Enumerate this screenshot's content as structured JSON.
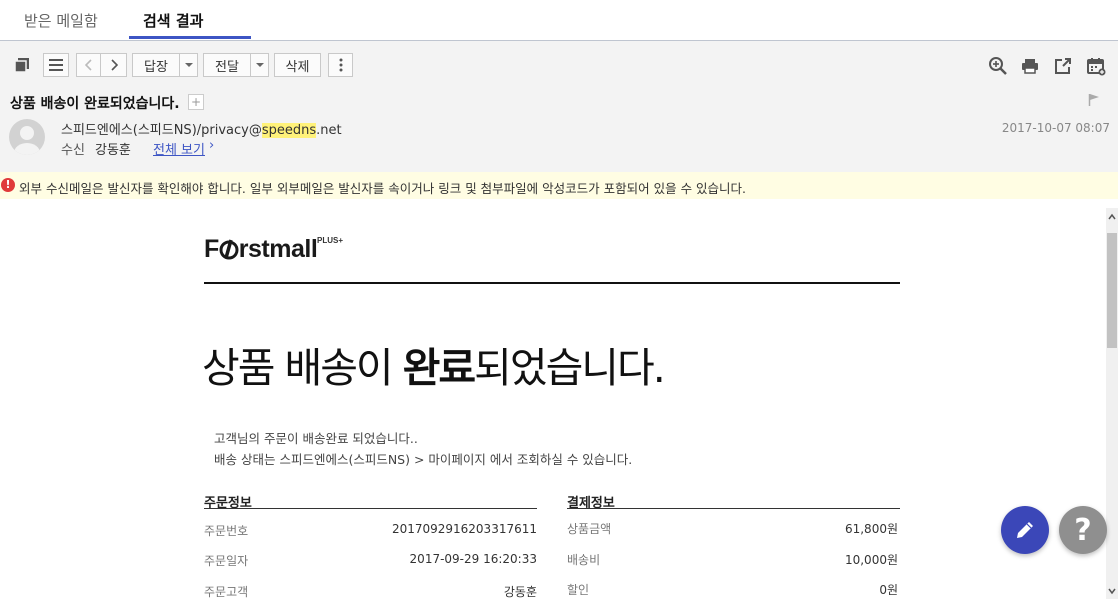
{
  "tabs": [
    {
      "label": "받은 메일함"
    },
    {
      "label": "검색 결과",
      "active": true
    }
  ],
  "toolbar": {
    "prev_icon": "chevron-left-icon",
    "next_icon": "chevron-right-icon",
    "reply_label": "답장",
    "forward_label": "전달",
    "delete_label": "삭제"
  },
  "message": {
    "subject": "상품 배송이 완료되었습니다.",
    "add_label": "+",
    "sender_prefix": "스피드엔에스(스피드NS)/privacy@",
    "sender_highlight": "speedns",
    "sender_suffix": ".net",
    "date": "2017-10-07 08:07",
    "recipient_label": "수신",
    "recipient_name": "강동훈",
    "view_all_label": "전체 보기",
    "view_all_chevron": "›"
  },
  "warning": {
    "icon": "!",
    "text": "외부 수신메일은 발신자를 확인해야 합니다. 일부 외부메일은 발신자를 속이거나 링크 및 첨부파일에 악성코드가 포함되어 있을 수 있습니다."
  },
  "email_body": {
    "logo_text": "F rstmall",
    "logo_sup": "PLUS+",
    "headline_part1": "상품 배송이 ",
    "headline_bold": "완료",
    "headline_part2": "되었습니다.",
    "desc_line1": "고객님의 주문이 배송완료 되었습니다..",
    "desc_line2": "배송 상태는 스피드엔에스(스피드NS) > 마이페이지 에서 조회하실 수 있습니다.",
    "order_info": {
      "title": "주문정보",
      "rows": [
        {
          "label": "주문번호",
          "value": "2017092916203317611"
        },
        {
          "label": "주문일자",
          "value": "2017-09-29 16:20:33"
        },
        {
          "label": "주문고객",
          "value": "강동훈"
        }
      ]
    },
    "payment_info": {
      "title": "결제정보",
      "rows": [
        {
          "label": "상품금액",
          "value": "61,800원"
        },
        {
          "label": "배송비",
          "value": "10,000원"
        },
        {
          "label": "할인",
          "value": "0원"
        }
      ]
    }
  },
  "fab": {
    "write_icon": "pencil-icon",
    "help_label": "?"
  },
  "colors": {
    "accent": "#3d55c4",
    "warning_bg": "#fffde3",
    "warning_icon": "#e03a3a",
    "fab_write": "#3b47b8",
    "fab_help": "#8f8f8f",
    "highlight": "#fff27a"
  }
}
